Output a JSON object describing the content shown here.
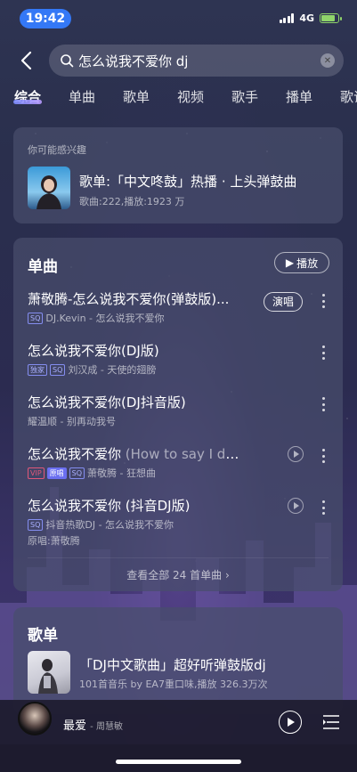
{
  "status_bar": {
    "time": "19:42",
    "network": "4G"
  },
  "search": {
    "value": "怎么说我不爱你 dj"
  },
  "tabs": [
    "综合",
    "单曲",
    "歌单",
    "视频",
    "歌手",
    "播单",
    "歌词"
  ],
  "recommend": {
    "label": "你可能感兴趣",
    "title": "歌单:「中文咚鼓」热播 · 上头弹鼓曲",
    "subtitle": "歌曲:222,播放:1923 万"
  },
  "songs_section": {
    "title": "单曲",
    "play_all": "播放",
    "perform_label": "演唱",
    "view_all": "查看全部 24 首单曲",
    "items": [
      {
        "title": "萧敬腾-怎么说我不爱你(弹鼓版)...",
        "alt": "",
        "tags": [
          "SQ"
        ],
        "meta": "DJ.Kevin - 怎么说我不爱你",
        "meta2": ""
      },
      {
        "title": "怎么说我不爱你(DJ版)",
        "alt": "",
        "tags": [
          "独家",
          "SQ"
        ],
        "meta": "刘汉成 - 天使的翅膀",
        "meta2": ""
      },
      {
        "title": "怎么说我不爱你(DJ抖音版)",
        "alt": "",
        "tags": [],
        "meta": "耀温顺 - 别再动我号",
        "meta2": ""
      },
      {
        "title": "怎么说我不爱你 ",
        "alt": "(How to say I do...",
        "tags": [
          "VIP",
          "原唱",
          "SQ"
        ],
        "meta": "萧敬腾 - 狂想曲",
        "meta2": ""
      },
      {
        "title": "怎么说我不爱你 (抖音DJ版)",
        "alt": "",
        "tags": [
          "SQ"
        ],
        "meta": "抖音热歌DJ - 怎么说我不爱你",
        "meta2": "原唱:萧敬腾"
      }
    ]
  },
  "playlist_section": {
    "title": "歌单",
    "item": {
      "title": "「DJ中文歌曲」超好听弹鼓版dj",
      "subtitle": "101首音乐  by EA7重口味,播放 326.3万次"
    }
  },
  "player": {
    "title": "最爱",
    "artist": "- 周慧敏"
  }
}
